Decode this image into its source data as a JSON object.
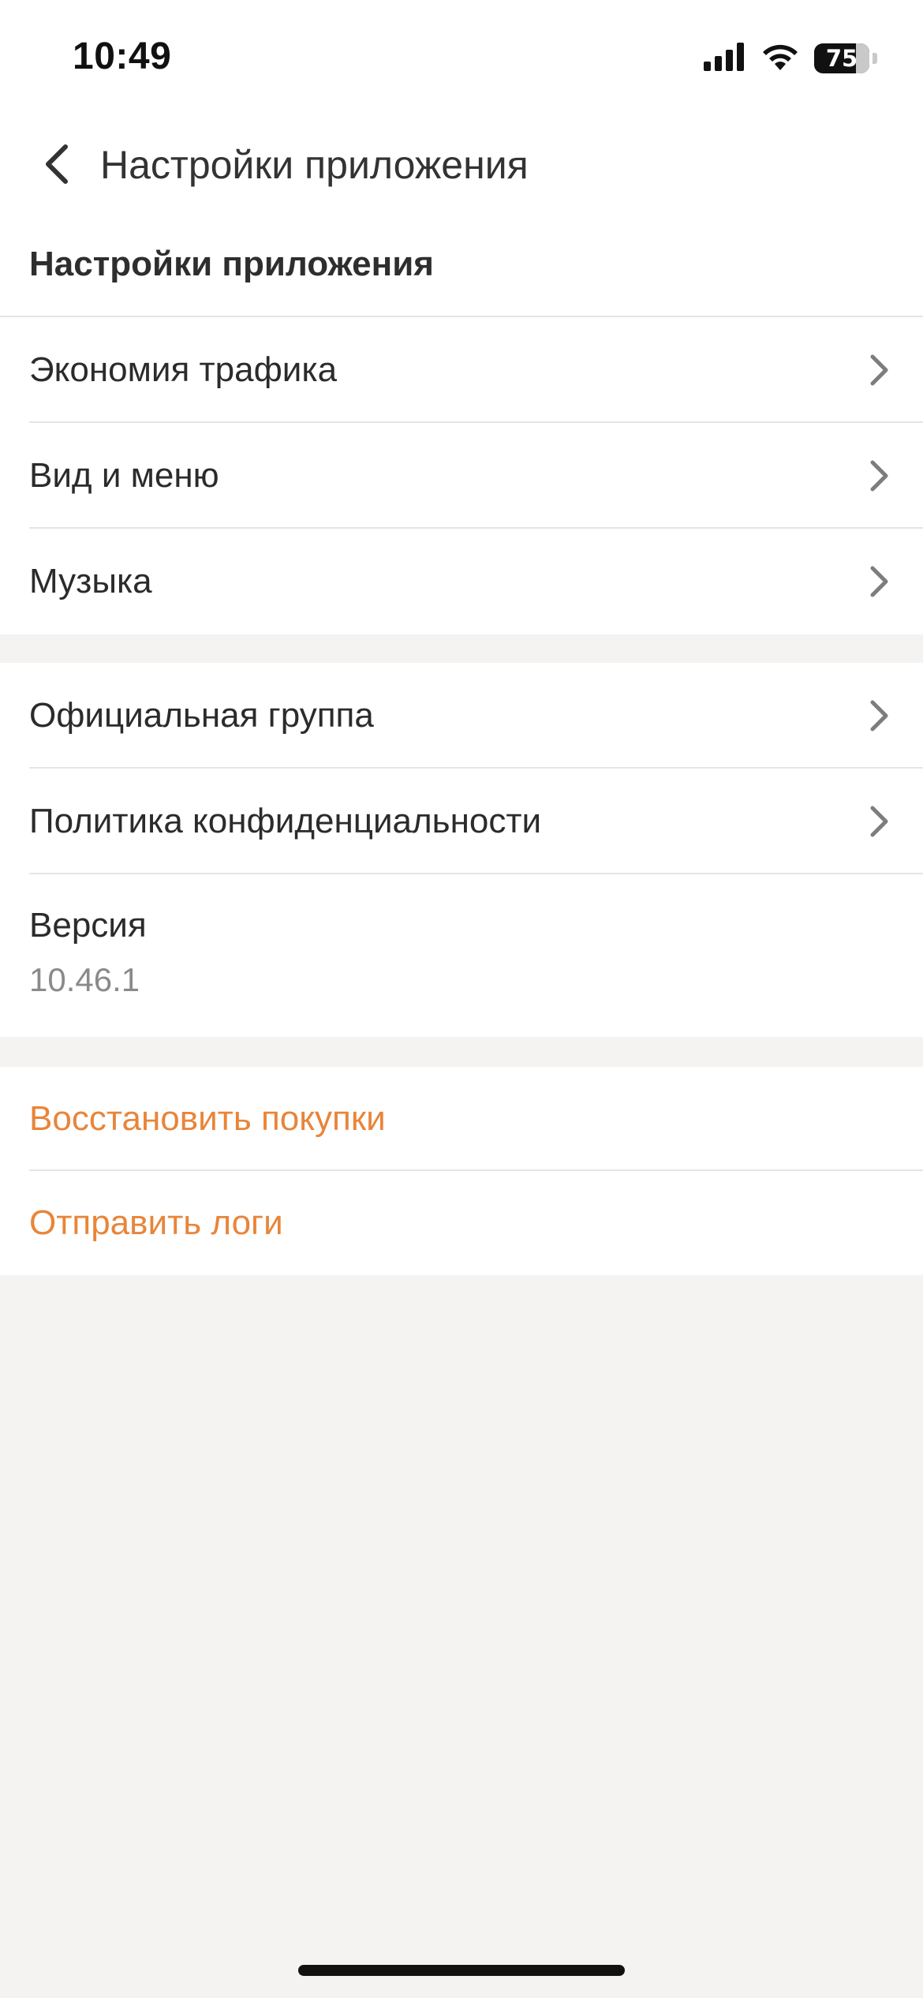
{
  "status_bar": {
    "time": "10:49",
    "battery_level": "75",
    "icons": [
      "signal-icon",
      "wifi-icon",
      "battery-icon"
    ]
  },
  "navbar": {
    "back_icon": "chevron-left-icon",
    "title": "Настройки приложения"
  },
  "settings_section": {
    "header": "Настройки приложения",
    "items": [
      {
        "label": "Экономия трафика"
      },
      {
        "label": "Вид и меню"
      },
      {
        "label": "Музыка"
      }
    ]
  },
  "info_section": {
    "items": [
      {
        "label": "Официальная группа"
      },
      {
        "label": "Политика конфиденциальности"
      }
    ],
    "version_label": "Версия",
    "version_value": "10.46.1"
  },
  "actions_section": {
    "restore_purchases": "Восстановить покупки",
    "send_logs": "Отправить логи"
  },
  "colors": {
    "accent": "#e8853a",
    "background": "#f4f3f1",
    "surface": "#ffffff",
    "divider": "#e6e5e3"
  }
}
